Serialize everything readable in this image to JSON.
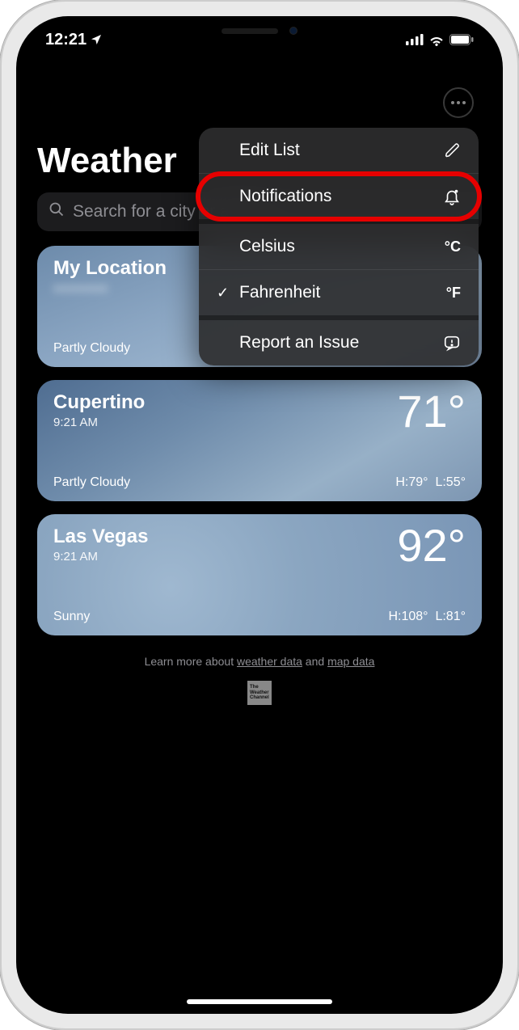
{
  "status": {
    "time": "12:21",
    "location_icon": "location-arrow"
  },
  "header": {
    "title": "Weather",
    "more_icon": "ellipsis"
  },
  "search": {
    "placeholder": "Search for a city or airport",
    "icon": "magnifying-glass"
  },
  "cards": [
    {
      "title": "My Location",
      "subtitle": "",
      "temp": "",
      "condition": "Partly Cloudy",
      "hi": "",
      "lo": ""
    },
    {
      "title": "Cupertino",
      "subtitle": "9:21 AM",
      "temp": "71°",
      "condition": "Partly Cloudy",
      "hi": "H:79°",
      "lo": "L:55°"
    },
    {
      "title": "Las Vegas",
      "subtitle": "9:21 AM",
      "temp": "92°",
      "condition": "Sunny",
      "hi": "H:108°",
      "lo": "L:81°"
    }
  ],
  "menu": {
    "edit_list": "Edit List",
    "notifications": "Notifications",
    "celsius": "Celsius",
    "celsius_unit": "°C",
    "fahrenheit": "Fahrenheit",
    "fahrenheit_unit": "°F",
    "report_issue": "Report an Issue"
  },
  "footer": {
    "prefix": "Learn more about ",
    "link1": "weather data",
    "mid": " and ",
    "link2": "map data",
    "twc": "The Weather Channel"
  }
}
